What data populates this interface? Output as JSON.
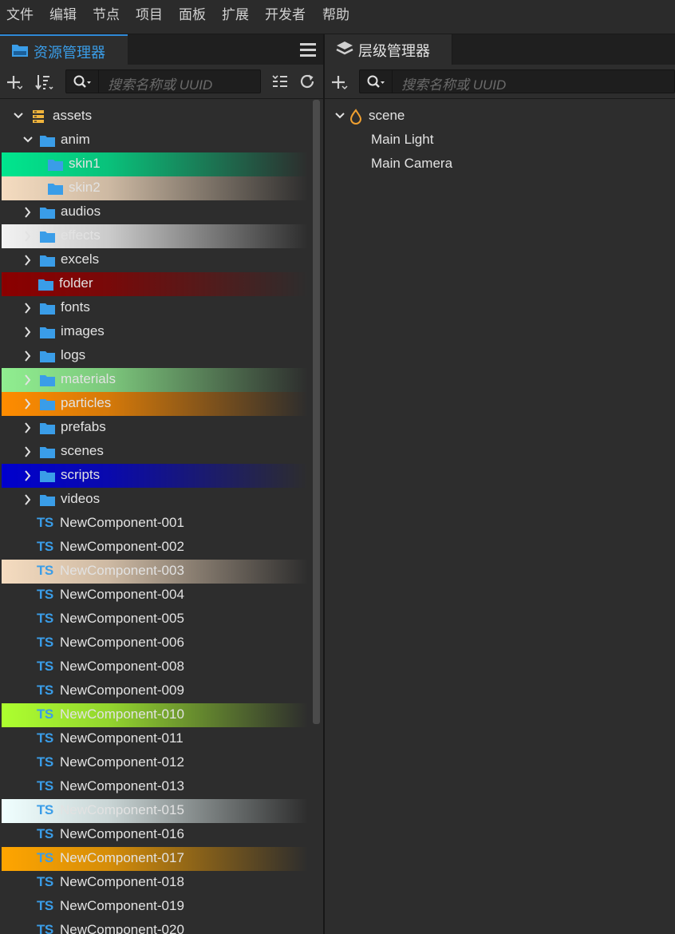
{
  "menu": [
    "文件",
    "编辑",
    "节点",
    "项目",
    "面板",
    "扩展",
    "开发者",
    "帮助"
  ],
  "asset_panel": {
    "title": "资源管理器",
    "search_placeholder": "搜索名称或 UUID",
    "rows": [
      {
        "label": "assets",
        "kind": "db",
        "arrow": "down",
        "indent": 0
      },
      {
        "label": "anim",
        "kind": "folder",
        "arrow": "down",
        "indent": 1
      },
      {
        "label": "skin1",
        "kind": "folder",
        "arrow": "none",
        "indent": 2,
        "highlight": "#00e68e"
      },
      {
        "label": "skin2",
        "kind": "folder",
        "arrow": "none",
        "indent": 2,
        "highlight": "#f5dcc0"
      },
      {
        "label": "audios",
        "kind": "folder",
        "arrow": "right",
        "indent": 1
      },
      {
        "label": "effects",
        "kind": "folder",
        "arrow": "right",
        "indent": 1,
        "highlight": "#f2f2f2"
      },
      {
        "label": "excels",
        "kind": "folder",
        "arrow": "right",
        "indent": 1
      },
      {
        "label": "folder",
        "kind": "folder",
        "arrow": "none",
        "indent": 1,
        "highlight": "#8b0000"
      },
      {
        "label": "fonts",
        "kind": "folder",
        "arrow": "right",
        "indent": 1
      },
      {
        "label": "images",
        "kind": "folder",
        "arrow": "right",
        "indent": 1
      },
      {
        "label": "logs",
        "kind": "folder",
        "arrow": "right",
        "indent": 1
      },
      {
        "label": "materials",
        "kind": "folder",
        "arrow": "right",
        "indent": 1,
        "highlight": "#90ee90"
      },
      {
        "label": "particles",
        "kind": "folder",
        "arrow": "right",
        "indent": 1,
        "highlight": "#ff8c00"
      },
      {
        "label": "prefabs",
        "kind": "folder",
        "arrow": "right",
        "indent": 1
      },
      {
        "label": "scenes",
        "kind": "folder",
        "arrow": "right",
        "indent": 1
      },
      {
        "label": "scripts",
        "kind": "folder",
        "arrow": "right",
        "indent": 1,
        "highlight": "#0000cd"
      },
      {
        "label": "videos",
        "kind": "folder",
        "arrow": "right",
        "indent": 1
      },
      {
        "label": "NewComponent-001",
        "kind": "ts",
        "arrow": "none",
        "indent": 1
      },
      {
        "label": "NewComponent-002",
        "kind": "ts",
        "arrow": "none",
        "indent": 1
      },
      {
        "label": "NewComponent-003",
        "kind": "ts",
        "arrow": "none",
        "indent": 1,
        "highlight": "#f5dcc0"
      },
      {
        "label": "NewComponent-004",
        "kind": "ts",
        "arrow": "none",
        "indent": 1
      },
      {
        "label": "NewComponent-005",
        "kind": "ts",
        "arrow": "none",
        "indent": 1
      },
      {
        "label": "NewComponent-006",
        "kind": "ts",
        "arrow": "none",
        "indent": 1
      },
      {
        "label": "NewComponent-008",
        "kind": "ts",
        "arrow": "none",
        "indent": 1
      },
      {
        "label": "NewComponent-009",
        "kind": "ts",
        "arrow": "none",
        "indent": 1
      },
      {
        "label": "NewComponent-010",
        "kind": "ts",
        "arrow": "none",
        "indent": 1,
        "highlight": "#adff2f"
      },
      {
        "label": "NewComponent-011",
        "kind": "ts",
        "arrow": "none",
        "indent": 1
      },
      {
        "label": "NewComponent-012",
        "kind": "ts",
        "arrow": "none",
        "indent": 1
      },
      {
        "label": "NewComponent-013",
        "kind": "ts",
        "arrow": "none",
        "indent": 1
      },
      {
        "label": "NewComponent-015",
        "kind": "ts",
        "arrow": "none",
        "indent": 1,
        "highlight": "#f0ffff"
      },
      {
        "label": "NewComponent-016",
        "kind": "ts",
        "arrow": "none",
        "indent": 1
      },
      {
        "label": "NewComponent-017",
        "kind": "ts",
        "arrow": "none",
        "indent": 1,
        "highlight": "#ffa500"
      },
      {
        "label": "NewComponent-018",
        "kind": "ts",
        "arrow": "none",
        "indent": 1
      },
      {
        "label": "NewComponent-019",
        "kind": "ts",
        "arrow": "none",
        "indent": 1
      },
      {
        "label": "NewComponent-020",
        "kind": "ts",
        "arrow": "none",
        "indent": 1
      }
    ]
  },
  "hierarchy_panel": {
    "title": "层级管理器",
    "search_placeholder": "搜索名称或 UUID",
    "root": "scene",
    "children": [
      "Main Light",
      "Main Camera"
    ]
  },
  "colors": {
    "accent": "#3a9de8",
    "folder": "#3a9de8",
    "scene_icon": "#f0a030"
  }
}
